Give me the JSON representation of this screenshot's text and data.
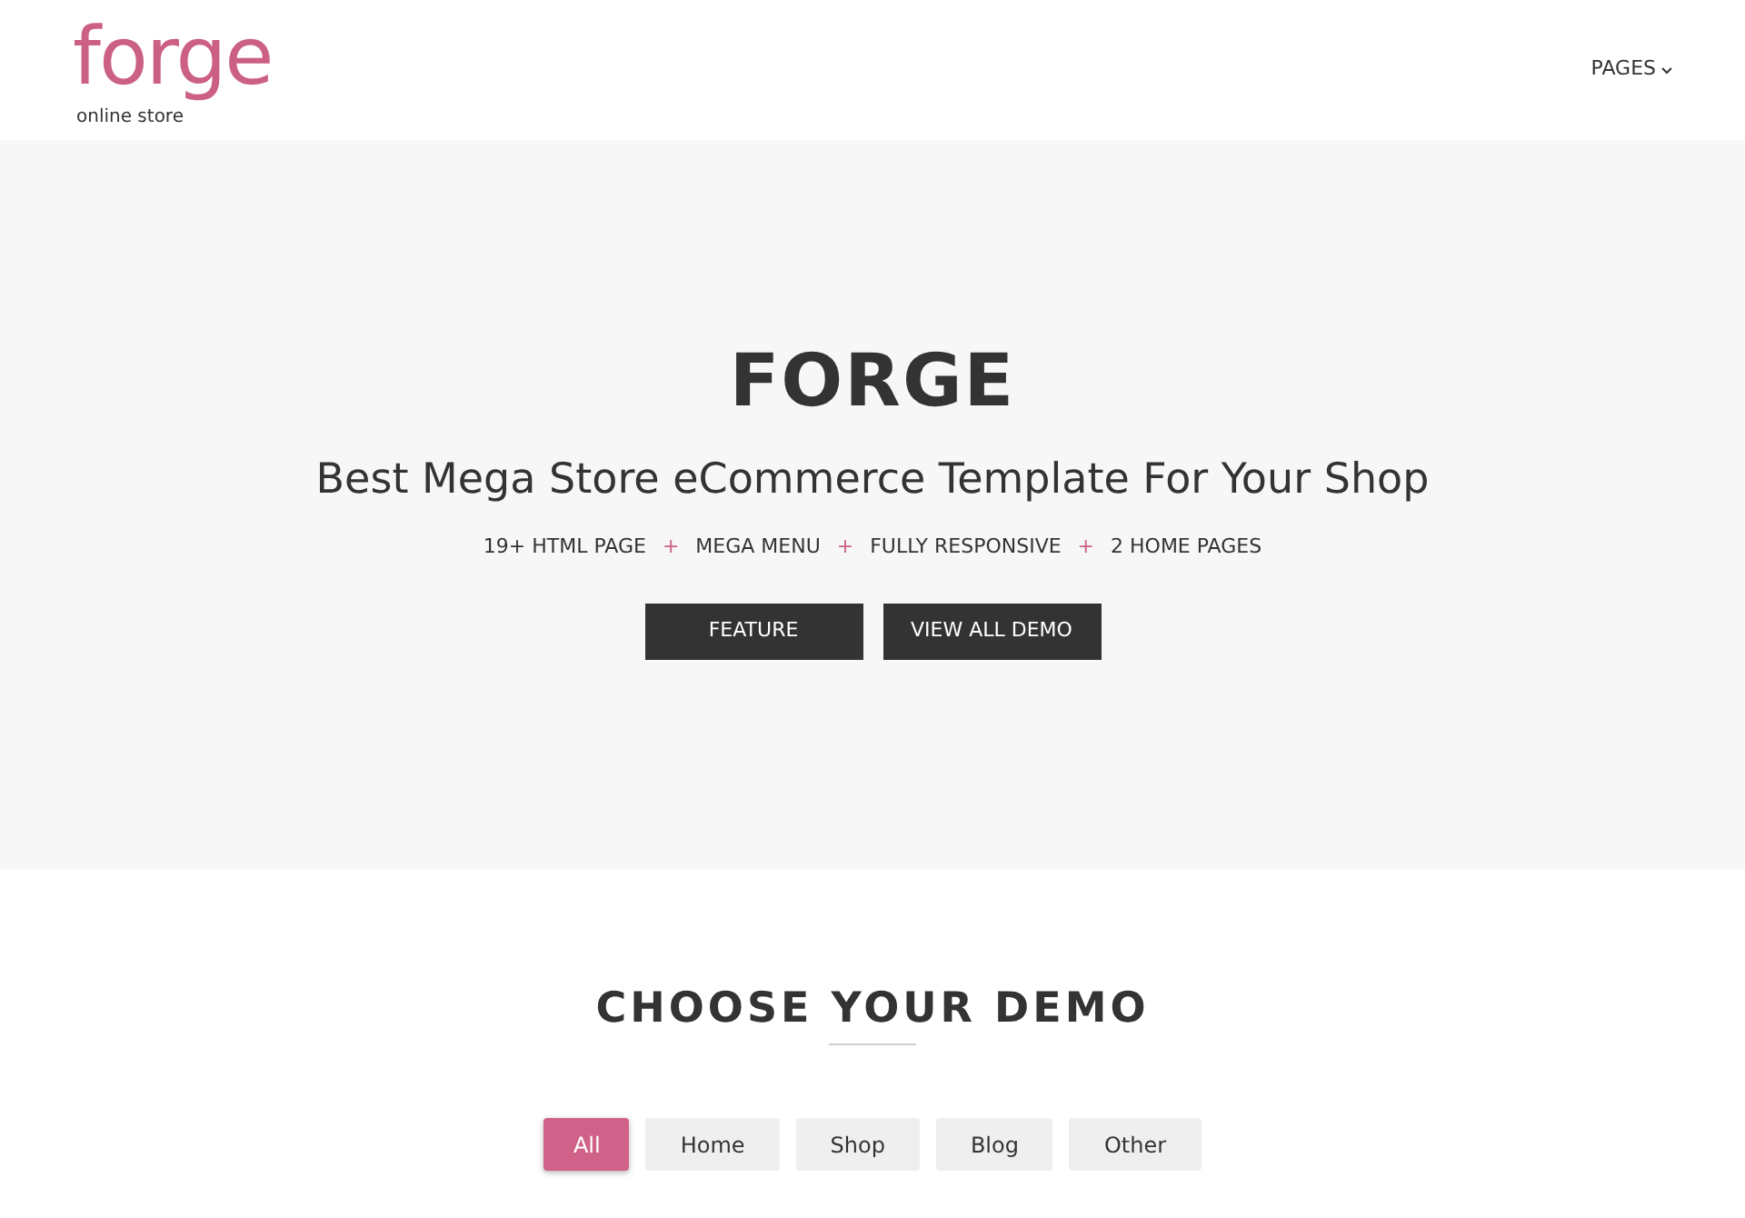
{
  "header": {
    "logo": {
      "name": "forge",
      "tagline": "online store"
    },
    "nav": [
      {
        "label": "PAGES"
      }
    ]
  },
  "hero": {
    "title": "FORGE",
    "subtitle": "Best Mega Store eCommerce Template For Your Shop",
    "features": [
      {
        "kind": "feature",
        "text": "19+ HTML PAGE"
      },
      {
        "kind": "separator",
        "text": "+"
      },
      {
        "kind": "feature",
        "text": "MEGA MENU"
      },
      {
        "kind": "separator",
        "text": "+"
      },
      {
        "kind": "feature",
        "text": "FULLY RESPONSIVE"
      },
      {
        "kind": "separator",
        "text": "+"
      },
      {
        "kind": "feature",
        "text": "2 HOME PAGES"
      }
    ],
    "buttons": [
      "FEATURE",
      "VIEW ALL DEMO"
    ]
  },
  "demos": {
    "heading": "CHOOSE YOUR DEMO",
    "filters": [
      {
        "label": "All",
        "selected": true
      },
      {
        "label": "Home",
        "selected": false
      },
      {
        "label": "Shop",
        "selected": false
      },
      {
        "label": "Blog",
        "selected": false
      },
      {
        "label": "Other",
        "selected": false
      }
    ]
  }
}
